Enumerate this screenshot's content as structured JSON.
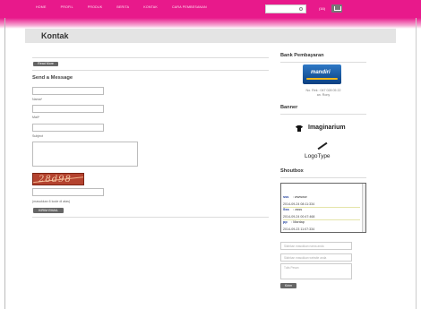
{
  "nav": {
    "items": [
      "HOME",
      "PROFIL",
      "PRODUK",
      "BERITA",
      "KONTAK",
      "CARA PEMBESANAN"
    ],
    "cart_label": "(16)"
  },
  "page": {
    "title": "Kontak"
  },
  "contact": {
    "read_more_label": "Read More",
    "form_title": "Send a Message",
    "name_label": "Nama*",
    "email_label": "Mail*",
    "subject_label": "Subject",
    "captcha_text": "28d98",
    "captcha_hint": "(masukkan 6 kode di atas)",
    "submit_label": "KIRIM EMAIL"
  },
  "sidebar": {
    "bank_title": "Bank Pembayaran",
    "bank_logo_text": "mandiri",
    "bank_account": "No. Rek : 047 028 05 22",
    "bank_owner": "an. Rony",
    "banner_title": "Banner",
    "banner1_text": "Imaginarium",
    "banner2_text": "LogoType",
    "shoutbox_title": "Shoutbox",
    "shouts": [
      {
        "name": "sss",
        "message": "wwwww",
        "date": "2014-09-24 08:11:334"
      },
      {
        "name": "Sss",
        "message": "asss",
        "date": "2014-09-24 00:47:468"
      },
      {
        "name": "pp",
        "message": "Mantap",
        "date": "2014-09-23 11:07:334"
      }
    ],
    "name_placeholder": "Silahkan masukkan nama anda",
    "website_placeholder": "Silahkan masukkan website anda",
    "message_placeholder": "Tulis Pesan",
    "send_label": "Kirim"
  }
}
